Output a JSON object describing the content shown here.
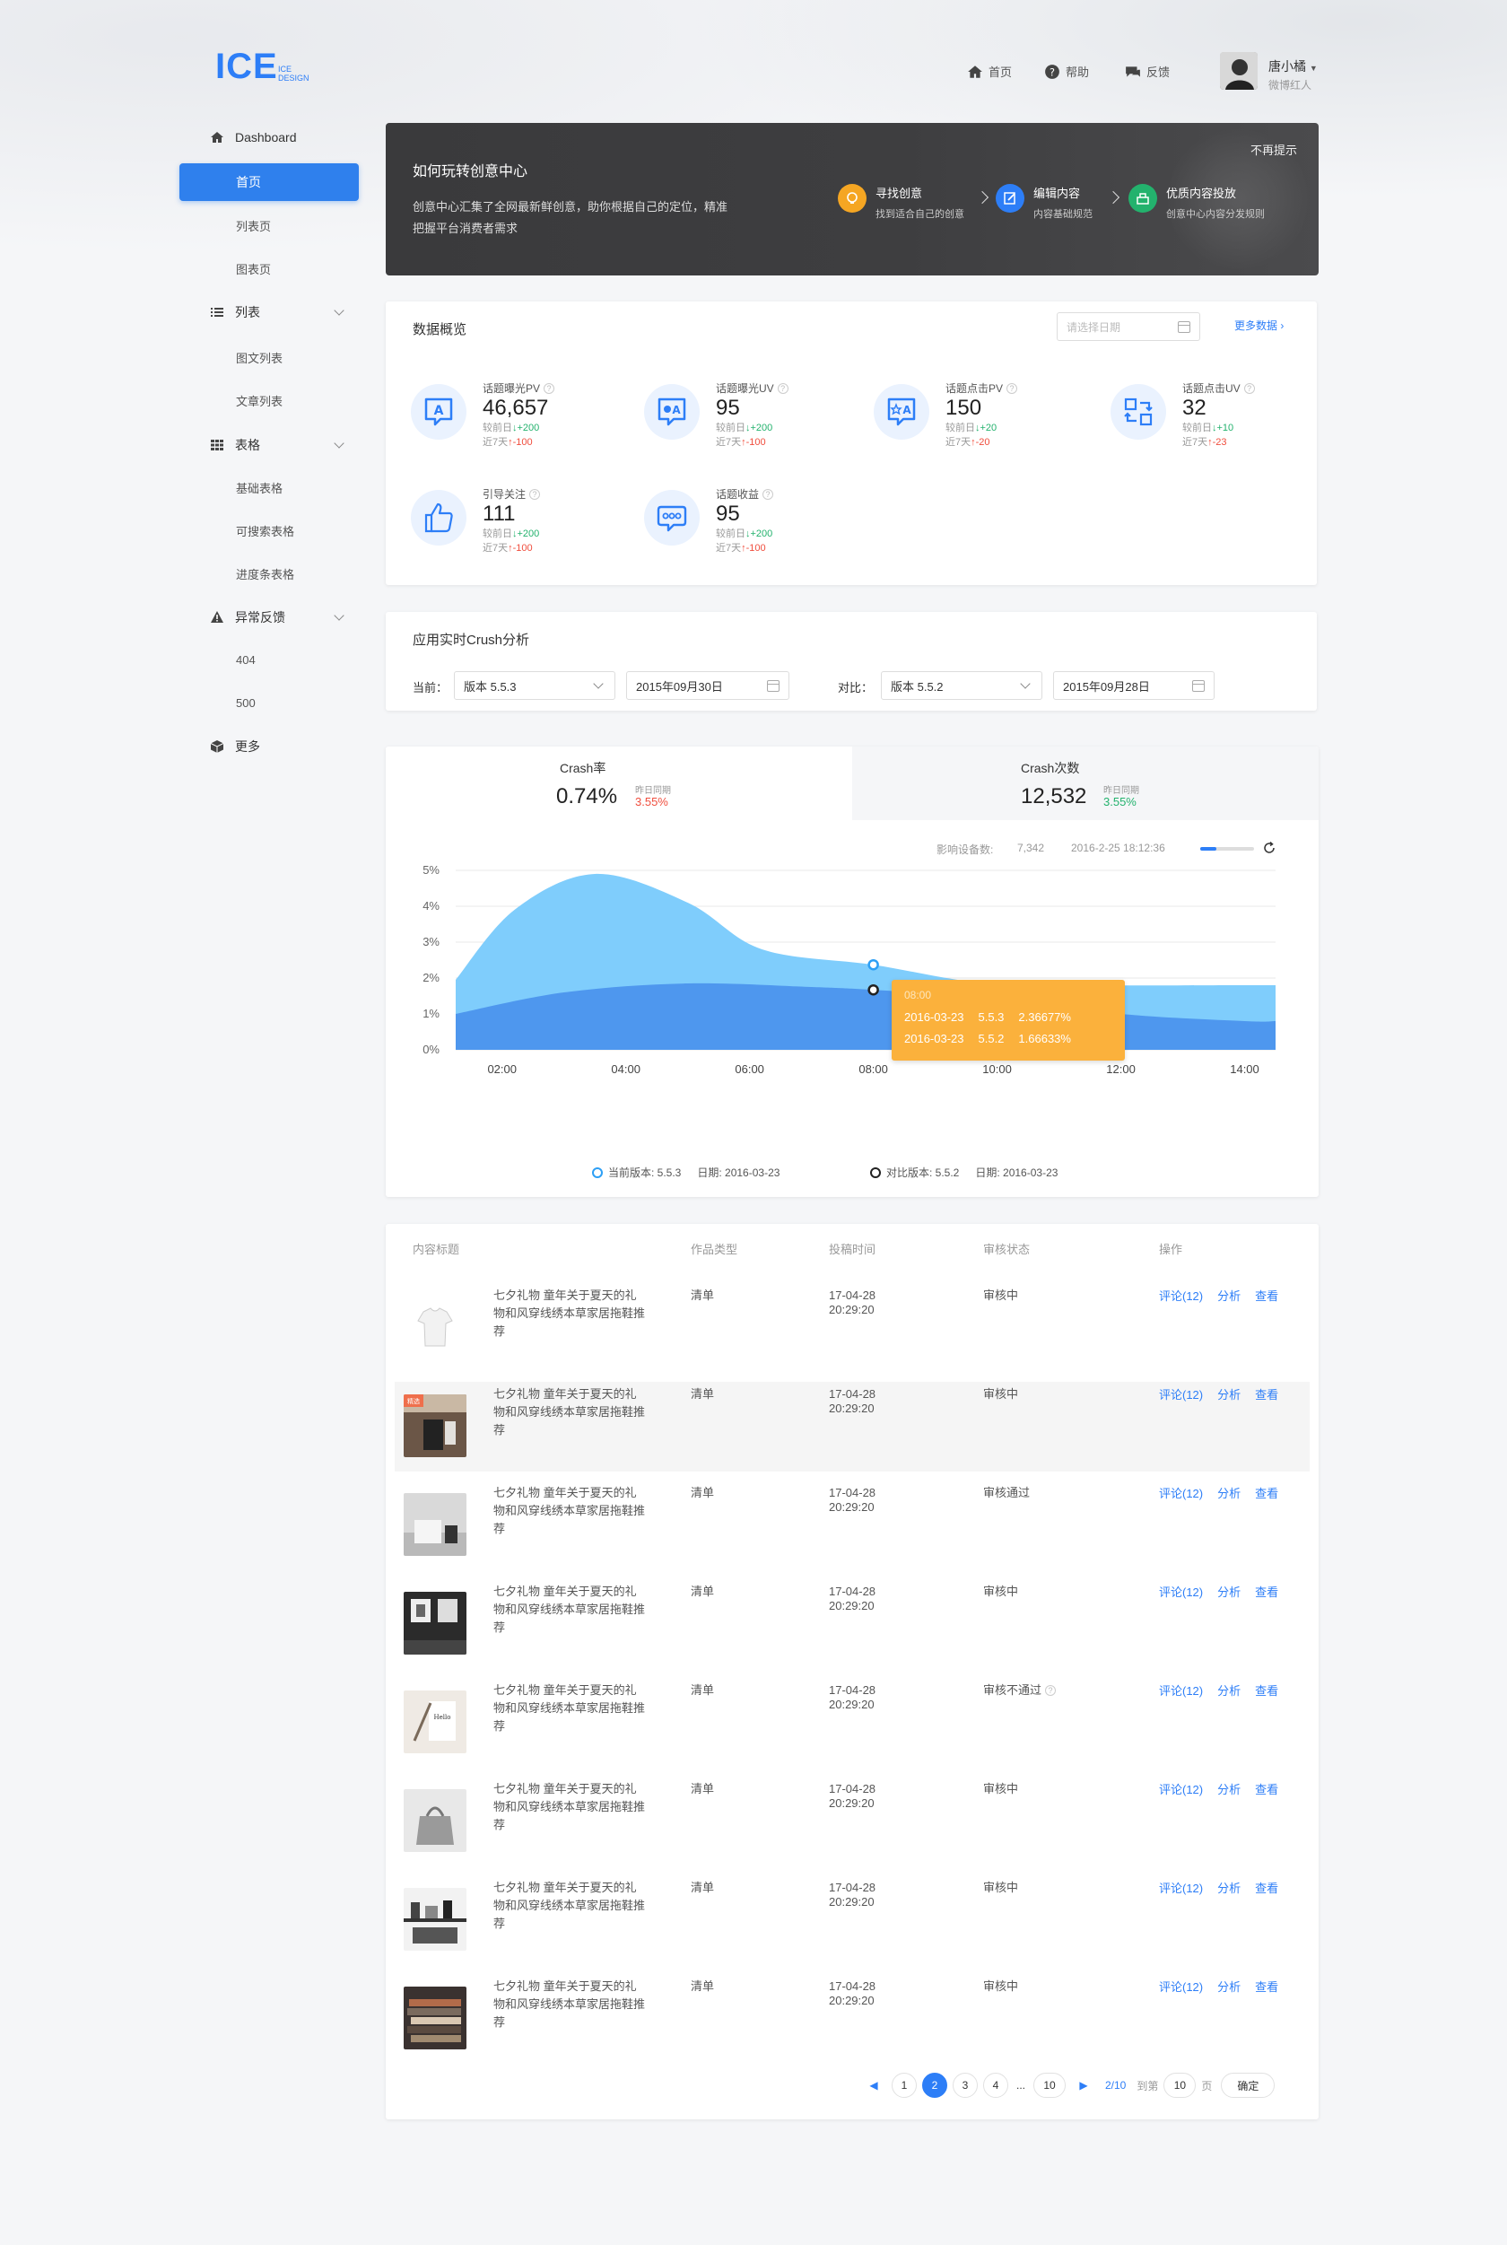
{
  "header": {
    "logo": "ICE",
    "logo_sub": "ICE DESIGN",
    "nav": [
      {
        "label": "首页",
        "icon": "home-icon"
      },
      {
        "label": "帮助",
        "icon": "help-icon"
      },
      {
        "label": "反馈",
        "icon": "feedback-icon"
      }
    ],
    "user": {
      "name": "唐小橘",
      "role": "微博红人"
    }
  },
  "sidebar": {
    "dashboard": "Dashboard",
    "home": "首页",
    "list_page": "列表页",
    "chart_page": "图表页",
    "list": "列表",
    "list_subs": [
      "图文列表",
      "文章列表"
    ],
    "table": "表格",
    "table_subs": [
      "基础表格",
      "可搜索表格",
      "进度条表格"
    ],
    "error": "异常反馈",
    "error_subs": [
      "404",
      "500"
    ],
    "more": "更多"
  },
  "banner": {
    "title": "如何玩转创意中心",
    "desc": "创意中心汇集了全网最新鲜创意，助你根据自己的定位，精准把握平台消费者需求",
    "close": "不再提示",
    "steps": [
      {
        "title": "寻找创意",
        "sub": "找到适合自己的创意",
        "color": "#f5a623"
      },
      {
        "title": "编辑内容",
        "sub": "内容基础规范",
        "color": "#2d7ef7"
      },
      {
        "title": "优质内容投放",
        "sub": "创意中心内容分发规则",
        "color": "#23b26d"
      }
    ]
  },
  "overview": {
    "title": "数据概览",
    "date_placeholder": "请选择日期",
    "more": "更多数据",
    "stats": [
      {
        "label": "话题曝光PV",
        "value": "46,657",
        "d1_label": "较前日",
        "d1": "+200",
        "d2_label": "近7天",
        "d2": "-100",
        "icon": "chat-a-icon"
      },
      {
        "label": "话题曝光UV",
        "value": "95",
        "d1_label": "较前日",
        "d1": "+200",
        "d2_label": "近7天",
        "d2": "-100",
        "icon": "chat-eye-icon"
      },
      {
        "label": "话题点击PV",
        "value": "150",
        "d1_label": "较前日",
        "d1": "+20",
        "d2_label": "近7天",
        "d2": "-20",
        "icon": "chat-star-icon"
      },
      {
        "label": "话题点击UV",
        "value": "32",
        "d1_label": "较前日",
        "d1": "+10",
        "d2_label": "近7天",
        "d2": "-23",
        "icon": "exchange-icon"
      },
      {
        "label": "引导关注",
        "value": "111",
        "d1_label": "较前日",
        "d1": "+200",
        "d2_label": "近7天",
        "d2": "-100",
        "icon": "thumb-up-icon"
      },
      {
        "label": "话题收益",
        "value": "95",
        "d1_label": "较前日",
        "d1": "+200",
        "d2_label": "近7天",
        "d2": "-100",
        "icon": "chat-dots-icon"
      }
    ]
  },
  "crash": {
    "title": "应用实时Crush分析",
    "current_label": "当前：",
    "current_version": "版本 5.5.3",
    "current_date": "2015年09月30日",
    "compare_label": "对比：",
    "compare_version": "版本 5.5.2",
    "compare_date": "2015年09月28日"
  },
  "crash_tabs": [
    {
      "title": "Crash率",
      "value": "0.74%",
      "cmp_label": "昨日同期",
      "cmp": "3.55%",
      "cmp_color": "#f04e3e"
    },
    {
      "title": "Crash次数",
      "value": "12,532",
      "cmp_label": "昨日同期",
      "cmp": "3.55%",
      "cmp_color": "#23b26d"
    }
  ],
  "chart_meta": {
    "devices_label": "影响设备数:",
    "devices": "7,342",
    "time": "2016-2-25 18:12:36",
    "tooltip_time": "08:00",
    "tooltip_rows": [
      {
        "date": "2016-03-23",
        "version": "5.5.3",
        "value": "2.36677%"
      },
      {
        "date": "2016-03-23",
        "version": "5.5.2",
        "value": "1.66633%"
      }
    ],
    "legend": [
      {
        "label": "当前版本: 5.5.3",
        "date": "日期: 2016-03-23"
      },
      {
        "label": "对比版本: 5.5.2",
        "date": "日期: 2016-03-23"
      }
    ]
  },
  "chart_data": {
    "type": "area",
    "x": [
      "02:00",
      "04:00",
      "06:00",
      "08:00",
      "10:00",
      "12:00",
      "14:00"
    ],
    "ylim": [
      0,
      5
    ],
    "yticks": [
      "0%",
      "1%",
      "2%",
      "3%",
      "4%",
      "5%"
    ],
    "series": [
      {
        "name": "当前版本: 5.5.3",
        "color": "#7fcdfc",
        "points": [
          [
            1.25,
            1.95
          ],
          [
            2.2,
            3.9
          ],
          [
            3.5,
            4.9
          ],
          [
            5.0,
            4.1
          ],
          [
            6.2,
            2.8
          ],
          [
            8.0,
            2.37
          ],
          [
            9.6,
            1.9
          ],
          [
            11.2,
            1.8
          ],
          [
            14.0,
            1.8
          ],
          [
            14.5,
            1.8
          ]
        ]
      },
      {
        "name": "对比版本: 5.5.2",
        "color": "#4e97ee",
        "points": [
          [
            1.25,
            1.0
          ],
          [
            3.0,
            1.6
          ],
          [
            5.0,
            1.85
          ],
          [
            7.0,
            1.75
          ],
          [
            8.0,
            1.67
          ],
          [
            10.0,
            1.45
          ],
          [
            12.0,
            1.0
          ],
          [
            14.0,
            0.8
          ],
          [
            14.5,
            0.8
          ]
        ]
      }
    ]
  },
  "table": {
    "headers": [
      "内容标题",
      "作品类型",
      "投稿时间",
      "审核状态",
      "操作"
    ],
    "rows": [
      {
        "title": "七夕礼物 童年关于夏天的礼物和风穿线绣本草家居拖鞋推荐",
        "type": "清单",
        "date": "17-04-28",
        "time": "20:29:20",
        "status": "审核中",
        "thumb": "tshirt"
      },
      {
        "title": "七夕礼物 童年关于夏天的礼物和风穿线绣本草家居拖鞋推荐",
        "type": "清单",
        "date": "17-04-28",
        "time": "20:29:20",
        "status": "审核中",
        "thumb": "dark",
        "tag": "精选"
      },
      {
        "title": "七夕礼物 童年关于夏天的礼物和风穿线绣本草家居拖鞋推荐",
        "type": "清单",
        "date": "17-04-28",
        "time": "20:29:20",
        "status": "审核通过",
        "thumb": "gray"
      },
      {
        "title": "七夕礼物 童年关于夏天的礼物和风穿线绣本草家居拖鞋推荐",
        "type": "清单",
        "date": "17-04-28",
        "time": "20:29:20",
        "status": "审核中",
        "thumb": "darkroom"
      },
      {
        "title": "七夕礼物 童年关于夏天的礼物和风穿线绣本草家居拖鞋推荐",
        "type": "清单",
        "date": "17-04-28",
        "time": "20:29:20",
        "status": "审核不通过",
        "thumb": "paper",
        "has_q": true
      },
      {
        "title": "七夕礼物 童年关于夏天的礼物和风穿线绣本草家居拖鞋推荐",
        "type": "清单",
        "date": "17-04-28",
        "time": "20:29:20",
        "status": "审核中",
        "thumb": "bag"
      },
      {
        "title": "七夕礼物 童年关于夏天的礼物和风穿线绣本草家居拖鞋推荐",
        "type": "清单",
        "date": "17-04-28",
        "time": "20:29:20",
        "status": "审核中",
        "thumb": "shelf"
      },
      {
        "title": "七夕礼物 童年关于夏天的礼物和风穿线绣本草家居拖鞋推荐",
        "type": "清单",
        "date": "17-04-28",
        "time": "20:29:20",
        "status": "审核中",
        "thumb": "books"
      }
    ],
    "actions": [
      "评论(12)",
      "分析",
      "查看"
    ]
  },
  "pagination": {
    "pages": [
      "1",
      "2",
      "3",
      "4",
      "...",
      "10"
    ],
    "current": "2",
    "summary": "2/10",
    "goto_label": "到第",
    "goto_value": "10",
    "page_unit": "页",
    "confirm": "确定"
  }
}
